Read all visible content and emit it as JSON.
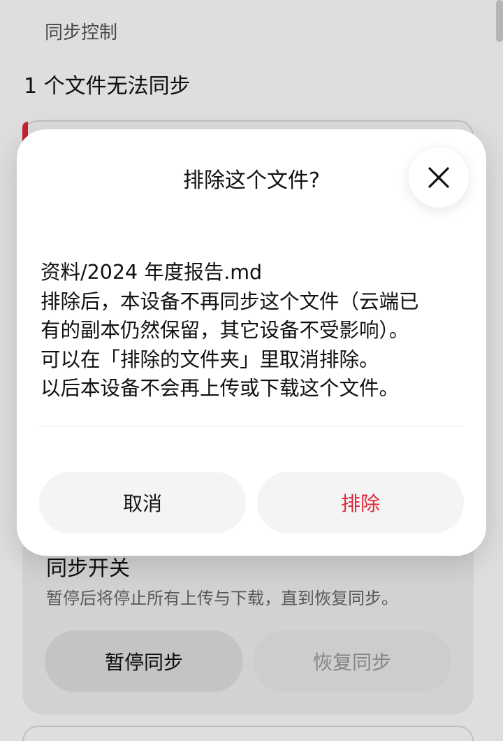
{
  "page": {
    "section_title": "同步控制",
    "issue_title": "1 个文件无法同步"
  },
  "sync_card": {
    "title": "同步开关",
    "description": "暂停后将停止所有上传与下载，直到恢复同步。",
    "pause_label": "暂停同步",
    "resume_label": "恢复同步"
  },
  "dialog": {
    "title": "排除这个文件?",
    "close_icon": "close-icon",
    "body_lines": [
      "资料/2024 年度报告.md",
      "排除后，本设备不再同步这个文件（云端已",
      "有的副本仍然保留，其它设备不受影响）。",
      "可以在「排除的文件夹」里取消排除。",
      "以后本设备不会再上传或下载这个文件。"
    ],
    "cancel_label": "取消",
    "confirm_label": "排除"
  },
  "colors": {
    "accent_red": "#e0283c",
    "scrim": "rgba(0,0,0,0.13)"
  }
}
